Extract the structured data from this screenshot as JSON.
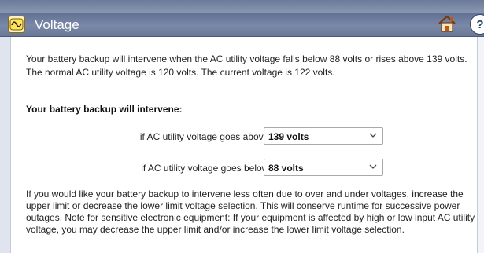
{
  "header": {
    "title": "Voltage",
    "app_icon": "battery-backup-icon",
    "home_icon": "home-icon",
    "help_icon": "help-icon",
    "help_glyph": "?"
  },
  "intro": {
    "line1": "Your battery backup will intervene when the AC utility voltage falls below 88 volts or rises above 139 volts.",
    "line2": "The normal AC utility voltage is 120 volts. The current voltage is 122 volts."
  },
  "settings": {
    "heading": "Your battery backup will intervene:",
    "upper": {
      "label": "if AC utility voltage goes above :",
      "value": "139 volts"
    },
    "lower": {
      "label": "if AC utility voltage goes below :",
      "value": "88 volts"
    }
  },
  "note": "If you would like your battery backup to intervene less often due to over and under voltages, increase the upper limit or decrease the lower limit voltage selection. This will conserve runtime for successive power outages. Note for sensitive electronic equipment: If your equipment is affected by high or low input AC utility voltage, you may decrease the upper limit and/or increase the lower limit voltage selection.",
  "colors": {
    "title_bar": "#6b7a99",
    "title_text": "#ffffff"
  }
}
